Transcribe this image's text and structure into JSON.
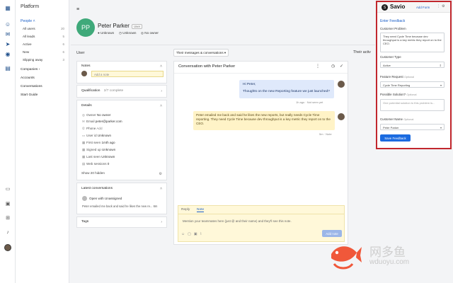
{
  "nav": {
    "title": "Platform",
    "people": "People",
    "subs": [
      {
        "label": "All users",
        "count": "20"
      },
      {
        "label": "All leads",
        "count": "5"
      },
      {
        "label": "Active",
        "count": "6"
      },
      {
        "label": "New",
        "count": "6"
      },
      {
        "label": "Slipping away",
        "count": "3"
      }
    ],
    "items": [
      "Companies",
      "Accounts",
      "Conversations",
      "Start Guide"
    ]
  },
  "contact": {
    "initials": "PP",
    "name": "Peter Parker",
    "badge": "User",
    "meta": [
      "Unknown",
      "Unknown",
      "No owner"
    ]
  },
  "user_panel": {
    "heading": "User",
    "notes_title": "Notes",
    "note_placeholder": "Add a note",
    "qualification_title": "Qualification",
    "qualification_value": "2/7 complete",
    "details_title": "Details",
    "details": [
      {
        "label": "Owner",
        "value": "No owner"
      },
      {
        "label": "Email",
        "value": "peter@parker.com"
      },
      {
        "label": "Phone",
        "value": "Add"
      },
      {
        "label": "User id",
        "value": "Unknown"
      },
      {
        "label": "First seen",
        "value": "1mth ago"
      },
      {
        "label": "Signed up",
        "value": "Unknown"
      },
      {
        "label": "Last seen",
        "value": "Unknown"
      },
      {
        "label": "Web sessions",
        "value": "0"
      }
    ],
    "show_hidden": "Show 20 hidden",
    "latest_title": "Latest conversations",
    "latest_item": "Open with Unassigned",
    "latest_preview": "Peter emailed me back and said he likes the new re...",
    "latest_time": "6m",
    "tags_title": "Tags"
  },
  "conversation": {
    "filter": "Their messages & conversations",
    "title": "Conversation with Peter Parker",
    "out_line1": "Hi Peter,",
    "out_line2": "Thoughts on the new Reporting feature we just launched?",
    "out_meta": "1h ago · Not seen yet",
    "in_text": "Peter emailed me back and said he likes the new reports, but really needs Cycle Time reporting.  They need Cycle Time because dev throughput is a key metric they report on to the CEO.",
    "in_meta": "5m · Note",
    "reply_tab": "Reply",
    "note_tab": "Note",
    "reply_placeholder": "Mention your teammates here (just @ and their name) and they'll see this note.",
    "add_note": "Add note"
  },
  "their_activity": "Their activ",
  "savio": {
    "name": "Savio",
    "add_form": "Add Form",
    "heading": "Enter Feedback",
    "problem_label": "Customer Problem",
    "problem_value": "They need Cycle Time because dev throughput is a key metric they report on to the CEO.",
    "type_label": "Customer Type",
    "type_value": "Active",
    "feature_label": "Feature Request",
    "feature_opt": "Optional",
    "feature_value": "Cycle Time Reporting",
    "solution_label": "Possible Solution?",
    "solution_opt": "Optional",
    "solution_placeholder": "One potential solution to this problem is...",
    "customer_label": "Customer Name",
    "customer_opt": "Optional",
    "customer_value": "Peter Parker",
    "save_button": "Save Feedback"
  },
  "watermark": {
    "text": "网多鱼",
    "sub": "wduoyu.com"
  }
}
